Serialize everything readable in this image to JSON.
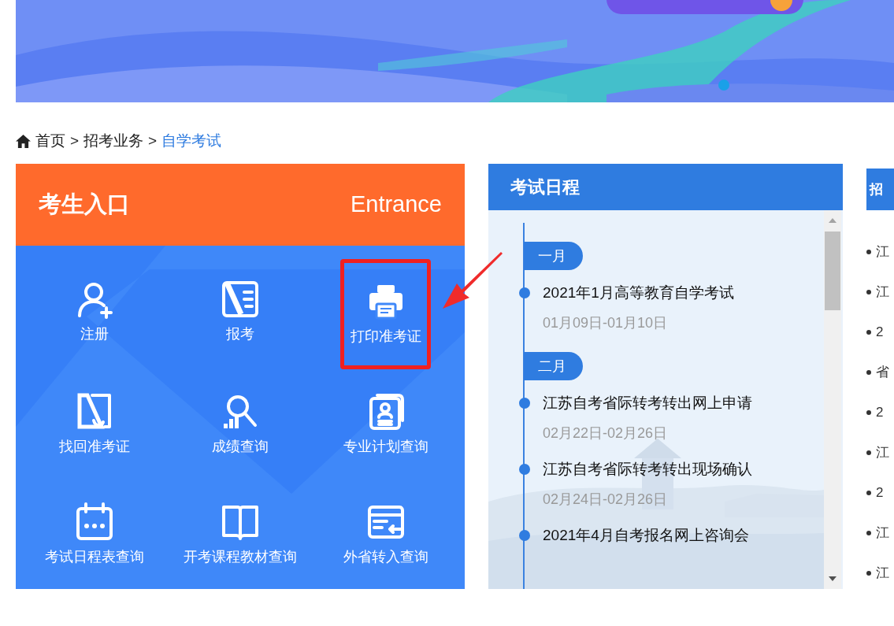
{
  "breadcrumb": [
    {
      "label": "首页",
      "current": false
    },
    {
      "label": "招考业务",
      "current": false
    },
    {
      "label": "自学考试",
      "current": true
    }
  ],
  "breadcrumb_separator": ">",
  "entrance": {
    "title": "考生入口",
    "subtitle": "Entrance",
    "items": [
      {
        "kind": "register",
        "label": "注册",
        "highlighted": false
      },
      {
        "kind": "apply",
        "label": "报考",
        "highlighted": false
      },
      {
        "kind": "print",
        "label": "打印准考证",
        "highlighted": true
      },
      {
        "kind": "recover",
        "label": "找回准考证",
        "highlighted": false
      },
      {
        "kind": "score",
        "label": "成绩查询",
        "highlighted": false
      },
      {
        "kind": "plan",
        "label": "专业计划查询",
        "highlighted": false
      },
      {
        "kind": "calendar",
        "label": "考试日程表查询",
        "highlighted": false
      },
      {
        "kind": "book",
        "label": "开考课程教材查询",
        "highlighted": false
      },
      {
        "kind": "transfer",
        "label": "外省转入查询",
        "highlighted": false
      }
    ]
  },
  "schedule": {
    "title": "考试日程",
    "entries": [
      {
        "kind": "month",
        "label": "一月"
      },
      {
        "kind": "event",
        "title": "2021年1月高等教育自学考试",
        "date": "01月09日-01月10日"
      },
      {
        "kind": "month",
        "label": "二月"
      },
      {
        "kind": "event",
        "title": "江苏自考省际转考转出网上申请",
        "date": "02月22日-02月26日"
      },
      {
        "kind": "event",
        "title": "江苏自考省际转考转出现场确认",
        "date": "02月24日-02月26日"
      },
      {
        "kind": "event",
        "title": "2021年4月自考报名网上咨询会"
      }
    ]
  },
  "right_panel": {
    "title": "招",
    "items": [
      "江",
      "江",
      "2",
      "省",
      "2",
      "江",
      "2",
      "江",
      "江"
    ]
  }
}
